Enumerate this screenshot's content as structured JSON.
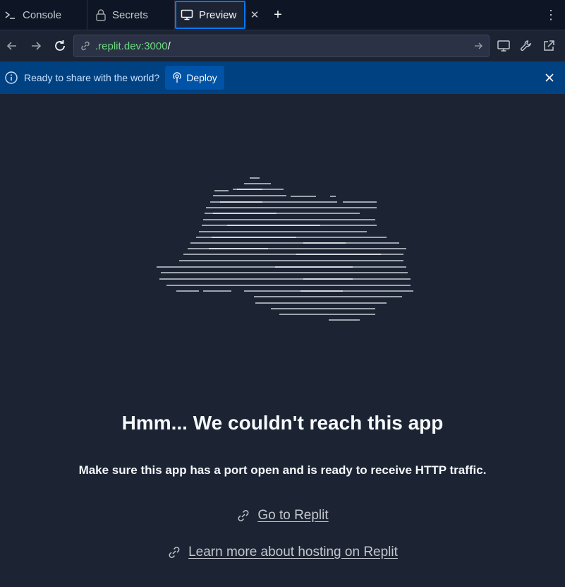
{
  "tabs": [
    {
      "label": "Console",
      "icon": "terminal-icon"
    },
    {
      "label": "Secrets",
      "icon": "lock-icon"
    },
    {
      "label": "Preview",
      "icon": "monitor-icon",
      "active": true
    }
  ],
  "tab_close_glyph": "✕",
  "tab_add_glyph": "+",
  "tab_menu_glyph": "⋮",
  "address": {
    "url_host": ".replit.dev:3000",
    "url_path": "/"
  },
  "banner": {
    "text": "Ready to share with the world?",
    "deploy_label": "Deploy"
  },
  "content": {
    "headline": "Hmm... We couldn't reach this app",
    "subline": "Make sure this app has a port open and is ready to receive HTTP traffic.",
    "link_replit": "Go to Replit",
    "link_hosting": "Learn more about hosting on Replit"
  },
  "colors": {
    "background": "#1c2333",
    "tabbar": "#0e1525",
    "active_tab_border": "#0079f2",
    "banner": "#004182",
    "deploy_button": "#0053a6",
    "url_host": "#6cd97e"
  }
}
